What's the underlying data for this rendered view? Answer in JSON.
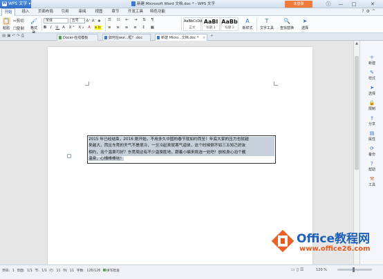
{
  "titlebar": {
    "app_name": "WPS 文字",
    "window_title": "新建 Microsoft Word 文档.doc * - WPS 文字",
    "login_button": "未登录",
    "controls": [
      "ⓘ",
      "—",
      "□",
      "✕"
    ]
  },
  "menu": {
    "tabs": [
      "开始",
      "插入",
      "页面布局",
      "引用",
      "审阅",
      "视图",
      "章节",
      "开发工具",
      "特色功能"
    ],
    "active_tab": "开始"
  },
  "ribbon": {
    "paste_label": "粘贴",
    "cut_label": "剪切",
    "copy_label": "复制",
    "format_painter_label": "格式刷",
    "font_name": "宋体",
    "font_size": "五号",
    "styles": [
      {
        "preview": "AaBbCcDd",
        "name": "正文"
      },
      {
        "preview": "AaBl",
        "name": "标题 1"
      },
      {
        "preview": "AaBb",
        "name": "标题 2"
      }
    ],
    "new_style_label": "新样式",
    "text_tool_label": "文字工具",
    "find_replace_label": "查找替换",
    "select_label": "选择"
  },
  "doc_tabs": [
    {
      "label": "Docer-在线模板",
      "icon": "docer-icon",
      "color": "#46a34a"
    },
    {
      "label": "如何在wor...框？.doc",
      "icon": "doc-icon",
      "color": "#3a78d4"
    },
    {
      "label": "新建 Micro...文档.doc *",
      "icon": "doc-icon",
      "color": "#3a78d4"
    }
  ],
  "document": {
    "line1": "2015 年已经结束，2016 刚开始，不用多久中国的春节就如约而至！年底大家的压力也就越",
    "line2": "来越大，而且东莞的天气不是很冷，一旦冷起来就寒气逼体，这个时候倒不如三五知己好友",
    "line3": "相约，泡个温泉可好？东莞周边有不少温泉胜地，跟着小编来挑选一处吧！放松身心泡个靓",
    "line4": "温泉，心情棒棒哒！"
  },
  "side_pane": [
    {
      "label": "新建",
      "icon": "plus-icon"
    },
    {
      "label": "样式",
      "icon": "style-icon"
    },
    {
      "label": "选择",
      "icon": "cursor-icon"
    },
    {
      "label": "限制",
      "icon": "lock-icon"
    },
    {
      "label": "分享",
      "icon": "share-icon"
    },
    {
      "label": "属性",
      "icon": "properties-icon"
    },
    {
      "label": "备份",
      "icon": "backup-icon"
    },
    {
      "label": "帮助",
      "icon": "help-icon"
    },
    {
      "label": "工具",
      "icon": "tool-icon"
    }
  ],
  "status": {
    "page": "页码: 1",
    "pages": "页面: 1/1",
    "section": "节: 1/1",
    "row": "行: 11",
    "col": "列: 11",
    "word_count": "字数: 126/126",
    "spell_check": "拼写检查",
    "zoom": "120 %"
  },
  "watermark": {
    "brand": "Office教程网",
    "url": "www.office26.com"
  }
}
